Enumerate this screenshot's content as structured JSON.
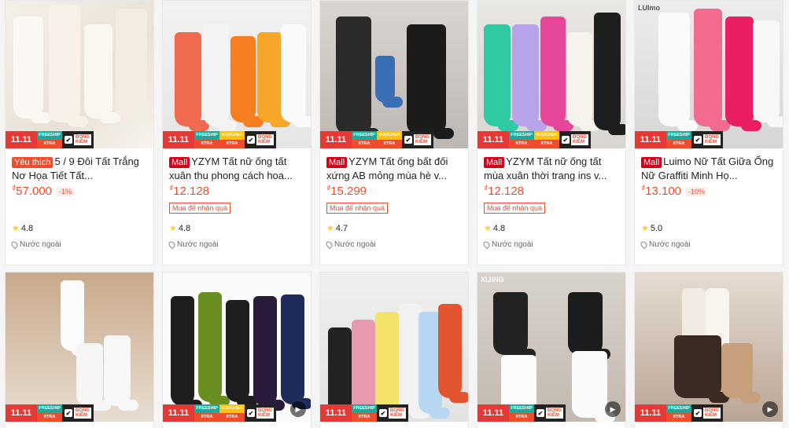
{
  "badges": {
    "sale": "11.11",
    "freeship_top": "FREESHIP",
    "freeship_bottom": "XTRA",
    "voucher_top": "VOUCHER",
    "voucher_bottom": "XTRA",
    "check_top": "ĐỒNG",
    "check_bottom": "KIỂM",
    "check_mark": "✔"
  },
  "play_glyph": "▶",
  "star_glyph": "★",
  "products": [
    {
      "tag": "Yêu thích",
      "tag_type": "fav",
      "title": "5 / 9 Đôi Tất Trắng Nơ Họa Tiết Tất...",
      "currency": "₫",
      "price": "57.000",
      "discount": "-1%",
      "promo": "",
      "rating": "4.8",
      "location": "Nước ngoài",
      "voucher": false
    },
    {
      "tag": "Mall",
      "tag_type": "mall",
      "title": "YZYM Tất nữ ống tất xuân thu phong cách hoa...",
      "currency": "₫",
      "price": "12.128",
      "discount": "",
      "promo": "Mua để nhận quà",
      "rating": "4.8",
      "location": "Nước ngoài",
      "voucher": true
    },
    {
      "tag": "Mall",
      "tag_type": "mall",
      "title": "YZYM Tất ống bất đối xứng AB mỏng mùa hè v...",
      "currency": "₫",
      "price": "15.299",
      "discount": "",
      "promo": "Mua để nhận quà",
      "rating": "4.7",
      "location": "Nước ngoài",
      "voucher": true
    },
    {
      "tag": "Mall",
      "tag_type": "mall",
      "title": "YZYM Tất nữ ống tất mùa xuân thời trang ins v...",
      "currency": "₫",
      "price": "12.128",
      "discount": "",
      "promo": "Mua để nhận quà",
      "rating": "4.8",
      "location": "Nước ngoài",
      "voucher": true
    },
    {
      "tag": "Mall",
      "tag_type": "mall",
      "title": "Luimo Nữ Tất Giữa Ống Nữ Graffiti Minh Họ...",
      "currency": "₫",
      "price": "13.100",
      "discount": "-10%",
      "promo": "",
      "rating": "5.0",
      "location": "Nước ngoài",
      "voucher": false,
      "corner": "LUImo"
    }
  ],
  "row2": [
    {
      "voucher": false,
      "play": false
    },
    {
      "voucher": true,
      "play": true
    },
    {
      "voucher": false,
      "play": false
    },
    {
      "voucher": false,
      "play": true,
      "corner": "XIJING"
    },
    {
      "voucher": false,
      "play": true
    }
  ],
  "colors": {
    "accent": "#ee4d2d",
    "mall": "#d0011b",
    "star": "#ffce3d"
  }
}
